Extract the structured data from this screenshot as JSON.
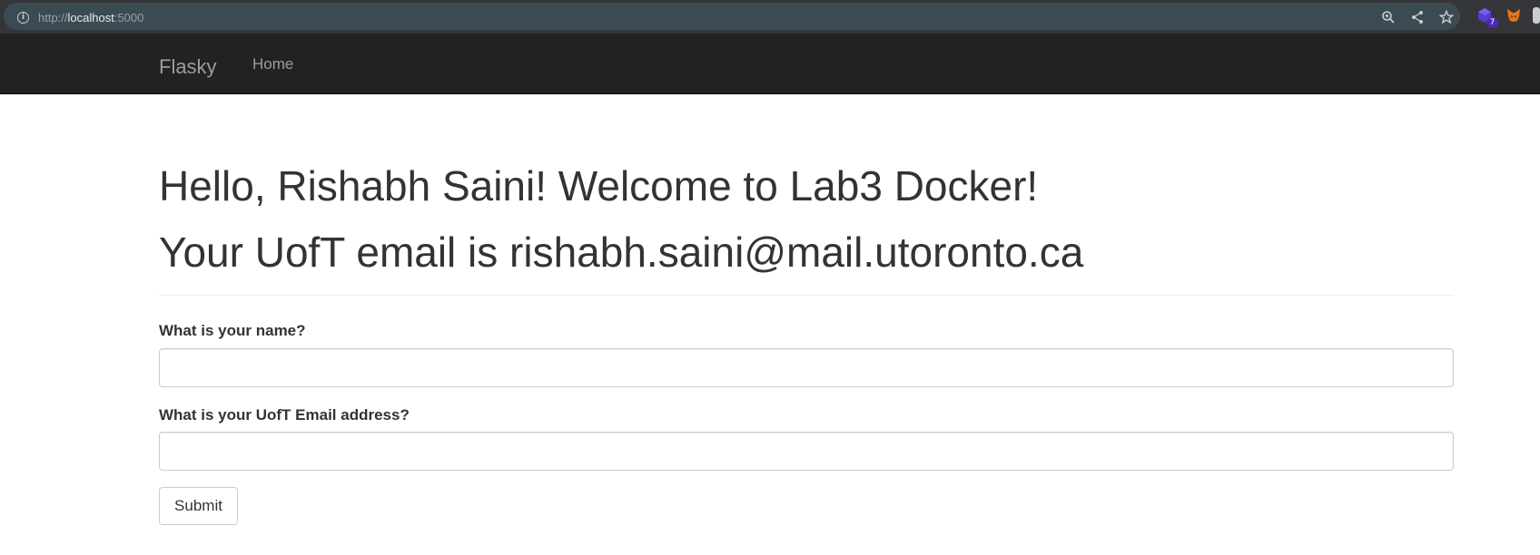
{
  "browser": {
    "url_prefix": "http://",
    "url_host": "localhost",
    "url_suffix": ":5000",
    "extension_badge": "7",
    "icons": [
      "info-icon",
      "zoom-icon",
      "share-icon",
      "bookmark-star-icon",
      "extension-icon",
      "metamask-fox-icon"
    ]
  },
  "navbar": {
    "brand": "Flasky",
    "links": [
      {
        "label": "Home"
      }
    ]
  },
  "main": {
    "greeting": "Hello, Rishabh Saini! Welcome to Lab3 Docker!",
    "email_line": "Your UofT email is rishabh.saini@mail.utoronto.ca"
  },
  "form": {
    "name_label": "What is your name?",
    "name_value": "",
    "email_label": "What is your UofT Email address?",
    "email_value": "",
    "submit_label": "Submit"
  },
  "colors": {
    "navbar_bg": "#222222",
    "navbar_text": "#9d9d9d",
    "body_text": "#333333",
    "input_border": "#cccccc"
  }
}
